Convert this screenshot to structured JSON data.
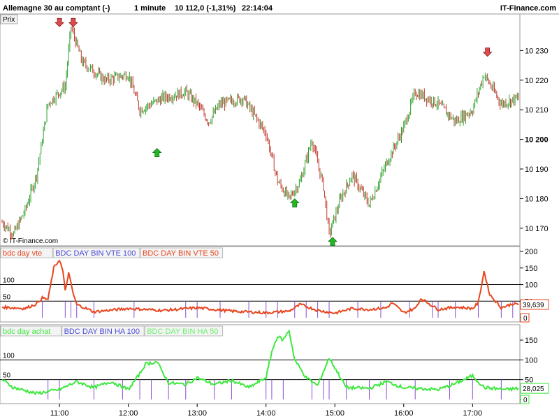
{
  "header": {
    "instrument": "Allemagne 30 au comptant (-)",
    "interval": "1 minute",
    "last": "10 112,0 (-1,31%)",
    "time": "22:14:04",
    "brand": "IT-Finance.com"
  },
  "price_label": "Prix",
  "watermark": "© IT-Finance.com",
  "colors": {
    "up": "#2ca02c",
    "down": "#c0392b",
    "sell_line": "#e8461e",
    "buy_line": "#3ee83e",
    "bar_purple": "#8a4fd8",
    "arrow_down": "#e04a4a",
    "arrow_up": "#22b822"
  },
  "chart_data": [
    {
      "type": "candlestick",
      "name": "price",
      "x_ticks": [
        "11:00",
        "12:00",
        "13:00",
        "14:00",
        "15:00",
        "16:00",
        "17:00"
      ],
      "y_ticks": [
        "10 170",
        "10 180",
        "10 190",
        "10 200",
        "10 210",
        "10 220",
        "10 230"
      ],
      "y_bold_tick": "10 200",
      "ylim": [
        10165,
        10240
      ],
      "x_start": "10:10",
      "x_end": "17:40",
      "path_points": [
        [
          "10:10",
          10172
        ],
        [
          "10:20",
          10168
        ],
        [
          "10:30",
          10176
        ],
        [
          "10:40",
          10188
        ],
        [
          "10:50",
          10212
        ],
        [
          "11:05",
          10218
        ],
        [
          "11:10",
          10238
        ],
        [
          "11:20",
          10226
        ],
        [
          "11:40",
          10220
        ],
        [
          "12:00",
          10222
        ],
        [
          "12:10",
          10210
        ],
        [
          "12:30",
          10214
        ],
        [
          "12:50",
          10216
        ],
        [
          "13:00",
          10212
        ],
        [
          "13:10",
          10206
        ],
        [
          "13:20",
          10212
        ],
        [
          "13:40",
          10214
        ],
        [
          "14:00",
          10202
        ],
        [
          "14:10",
          10186
        ],
        [
          "14:20",
          10180
        ],
        [
          "14:30",
          10186
        ],
        [
          "14:40",
          10200
        ],
        [
          "14:50",
          10184
        ],
        [
          "14:55",
          10168
        ],
        [
          "15:05",
          10180
        ],
        [
          "15:15",
          10188
        ],
        [
          "15:30",
          10178
        ],
        [
          "15:45",
          10192
        ],
        [
          "16:00",
          10204
        ],
        [
          "16:10",
          10216
        ],
        [
          "16:30",
          10212
        ],
        [
          "16:45",
          10206
        ],
        [
          "17:00",
          10210
        ],
        [
          "17:10",
          10222
        ],
        [
          "17:25",
          10212
        ],
        [
          "17:40",
          10214
        ]
      ],
      "signals": [
        {
          "time": "11:00",
          "type": "sell",
          "price": 10239
        },
        {
          "time": "11:12",
          "type": "sell",
          "price": 10239
        },
        {
          "time": "12:25",
          "type": "buy",
          "price": 10196
        },
        {
          "time": "14:25",
          "type": "buy",
          "price": 10179
        },
        {
          "time": "14:58",
          "type": "buy",
          "price": 10166
        },
        {
          "time": "17:13",
          "type": "sell",
          "price": 10229
        }
      ]
    },
    {
      "type": "line",
      "name": "bdc day vte",
      "legend": [
        {
          "label": "bdc day vte",
          "color": "#e8461e"
        },
        {
          "label": "BDC DAY BIN VTE 100",
          "color": "#4b4bd6"
        },
        {
          "label": "BDC DAY BIN VTE 50",
          "color": "#e8461e"
        }
      ],
      "level_labels": [
        "100",
        "50"
      ],
      "y_ticks": [
        "200",
        "150",
        "100",
        "50",
        "0"
      ],
      "ylim": [
        0,
        200
      ],
      "last_value": "39,639",
      "zero_label": "0",
      "points": [
        [
          "10:10",
          32
        ],
        [
          "10:30",
          28
        ],
        [
          "10:40",
          42
        ],
        [
          "10:45",
          60
        ],
        [
          "10:50",
          55
        ],
        [
          "10:55",
          150
        ],
        [
          "11:00",
          175
        ],
        [
          "11:03",
          140
        ],
        [
          "11:05",
          80
        ],
        [
          "11:08",
          135
        ],
        [
          "11:12",
          72
        ],
        [
          "11:15",
          40
        ],
        [
          "11:30",
          18
        ],
        [
          "12:00",
          28
        ],
        [
          "12:30",
          22
        ],
        [
          "13:00",
          30
        ],
        [
          "13:30",
          20
        ],
        [
          "14:00",
          15
        ],
        [
          "14:20",
          20
        ],
        [
          "14:30",
          40
        ],
        [
          "14:45",
          22
        ],
        [
          "15:00",
          14
        ],
        [
          "15:15",
          28
        ],
        [
          "15:30",
          25
        ],
        [
          "15:45",
          30
        ],
        [
          "15:50",
          45
        ],
        [
          "16:00",
          15
        ],
        [
          "16:10",
          28
        ],
        [
          "16:15",
          58
        ],
        [
          "16:30",
          25
        ],
        [
          "16:45",
          32
        ],
        [
          "17:00",
          28
        ],
        [
          "17:05",
          45
        ],
        [
          "17:10",
          140
        ],
        [
          "17:15",
          70
        ],
        [
          "17:25",
          30
        ],
        [
          "17:35",
          42
        ],
        [
          "17:40",
          40
        ]
      ],
      "signal_bars": [
        "10:45",
        "11:05",
        "11:10",
        "11:15",
        "11:30",
        "12:05",
        "12:50",
        "13:00",
        "13:20",
        "13:45",
        "14:00",
        "14:10",
        "14:25",
        "14:35",
        "14:45",
        "14:55",
        "15:20",
        "15:40",
        "16:05",
        "16:25",
        "16:30",
        "16:45",
        "17:05",
        "17:25",
        "17:35"
      ]
    },
    {
      "type": "line",
      "name": "bdc day achat",
      "legend": [
        {
          "label": "bdc day achat",
          "color": "#3ee83e"
        },
        {
          "label": "BDC DAY BIN HA 100",
          "color": "#4b4bd6"
        },
        {
          "label": "BDC DAY BIN HA 50",
          "color": "#6cf06c"
        }
      ],
      "level_labels": [
        "100",
        "50"
      ],
      "y_ticks": [
        "150",
        "100",
        "50",
        "0"
      ],
      "ylim": [
        0,
        180
      ],
      "last_value": "28,025",
      "zero_label": "0",
      "points": [
        [
          "10:10",
          50
        ],
        [
          "10:20",
          30
        ],
        [
          "10:40",
          15
        ],
        [
          "11:00",
          25
        ],
        [
          "11:15",
          45
        ],
        [
          "11:30",
          30
        ],
        [
          "11:45",
          45
        ],
        [
          "12:00",
          25
        ],
        [
          "12:10",
          65
        ],
        [
          "12:15",
          90
        ],
        [
          "12:25",
          95
        ],
        [
          "12:35",
          42
        ],
        [
          "12:50",
          38
        ],
        [
          "13:00",
          55
        ],
        [
          "13:15",
          38
        ],
        [
          "13:30",
          48
        ],
        [
          "13:45",
          30
        ],
        [
          "14:00",
          55
        ],
        [
          "14:05",
          120
        ],
        [
          "14:10",
          160
        ],
        [
          "14:15",
          150
        ],
        [
          "14:20",
          175
        ],
        [
          "14:25",
          100
        ],
        [
          "14:35",
          55
        ],
        [
          "14:45",
          35
        ],
        [
          "14:55",
          105
        ],
        [
          "15:00",
          80
        ],
        [
          "15:10",
          30
        ],
        [
          "15:30",
          28
        ],
        [
          "15:45",
          45
        ],
        [
          "16:00",
          30
        ],
        [
          "16:30",
          25
        ],
        [
          "16:45",
          40
        ],
        [
          "17:00",
          60
        ],
        [
          "17:10",
          30
        ],
        [
          "17:30",
          25
        ],
        [
          "17:40",
          28
        ]
      ],
      "signal_bars": [
        "10:50",
        "11:00",
        "11:30",
        "11:55",
        "12:10",
        "12:20",
        "12:35",
        "12:50",
        "13:15",
        "13:30",
        "14:00",
        "14:05",
        "14:15",
        "14:40",
        "14:50",
        "14:55",
        "15:10",
        "15:30",
        "15:45",
        "16:10",
        "16:40",
        "17:00",
        "17:25"
      ]
    }
  ]
}
